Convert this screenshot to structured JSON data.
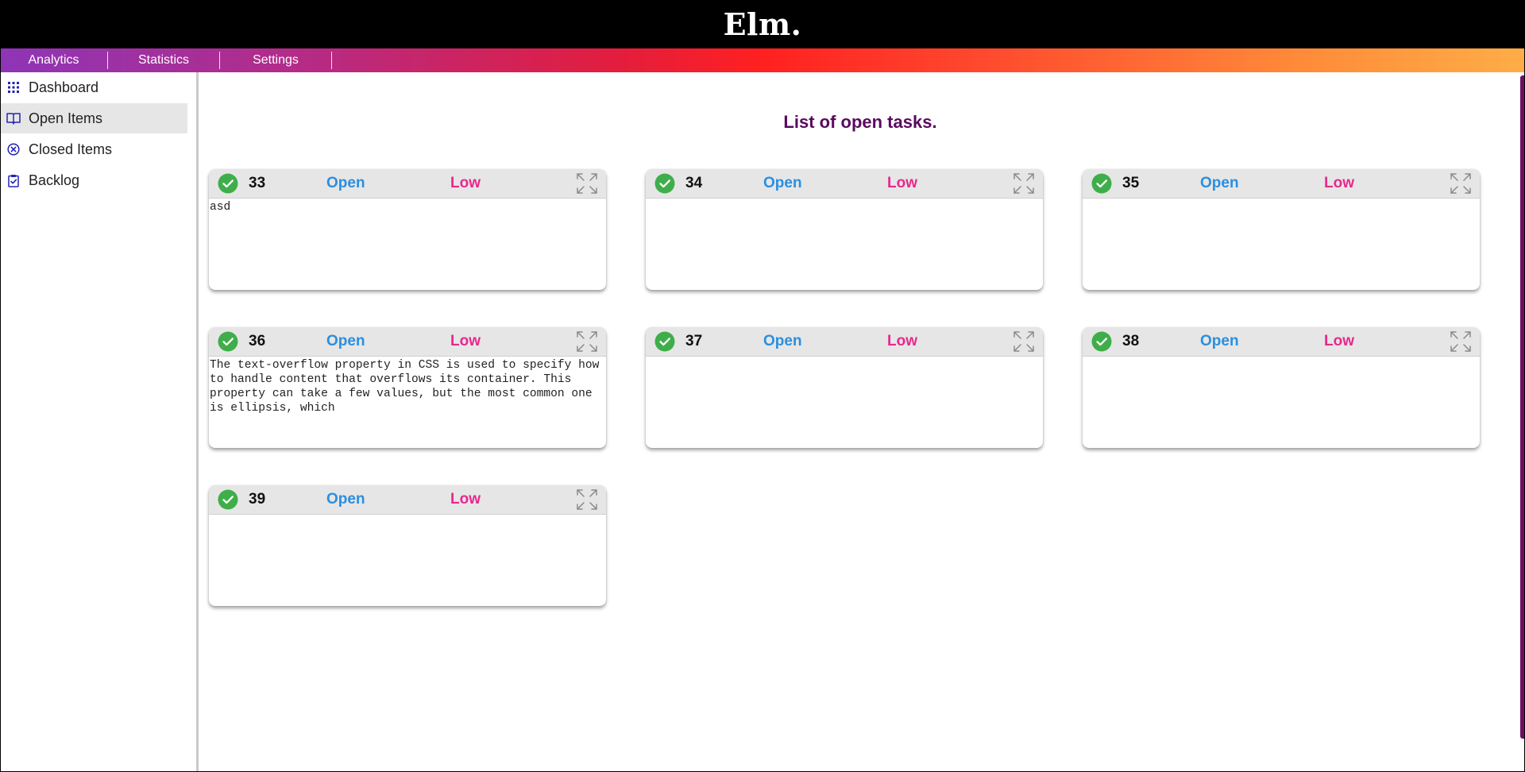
{
  "app": {
    "title": "Elm."
  },
  "nav": [
    {
      "label": "Analytics"
    },
    {
      "label": "Statistics"
    },
    {
      "label": "Settings"
    }
  ],
  "sidebar": {
    "items": [
      {
        "label": "Dashboard",
        "icon": "grid-icon",
        "active": false
      },
      {
        "label": "Open Items",
        "icon": "book-icon",
        "active": true
      },
      {
        "label": "Closed Items",
        "icon": "close-circle-icon",
        "active": false
      },
      {
        "label": "Backlog",
        "icon": "clipboard-check-icon",
        "active": false
      }
    ]
  },
  "main": {
    "heading": "List of open tasks.",
    "cards": [
      {
        "id": "33",
        "status": "Open",
        "priority": "Low",
        "body": "asd"
      },
      {
        "id": "34",
        "status": "Open",
        "priority": "Low",
        "body": ""
      },
      {
        "id": "35",
        "status": "Open",
        "priority": "Low",
        "body": ""
      },
      {
        "id": "36",
        "status": "Open",
        "priority": "Low",
        "body": "The text-overflow property in CSS is used to specify how to handle content that overflows its container. This property can take a few values, but the most common one is ellipsis, which"
      },
      {
        "id": "37",
        "status": "Open",
        "priority": "Low",
        "body": ""
      },
      {
        "id": "38",
        "status": "Open",
        "priority": "Low",
        "body": ""
      },
      {
        "id": "39",
        "status": "Open",
        "priority": "Low",
        "body": ""
      }
    ]
  },
  "colors": {
    "status": "#2a8fe0",
    "priority": "#e8288d",
    "heading": "#5a0a5f",
    "check": "#3fae4a",
    "sidebar_icon": "#2323b8"
  }
}
